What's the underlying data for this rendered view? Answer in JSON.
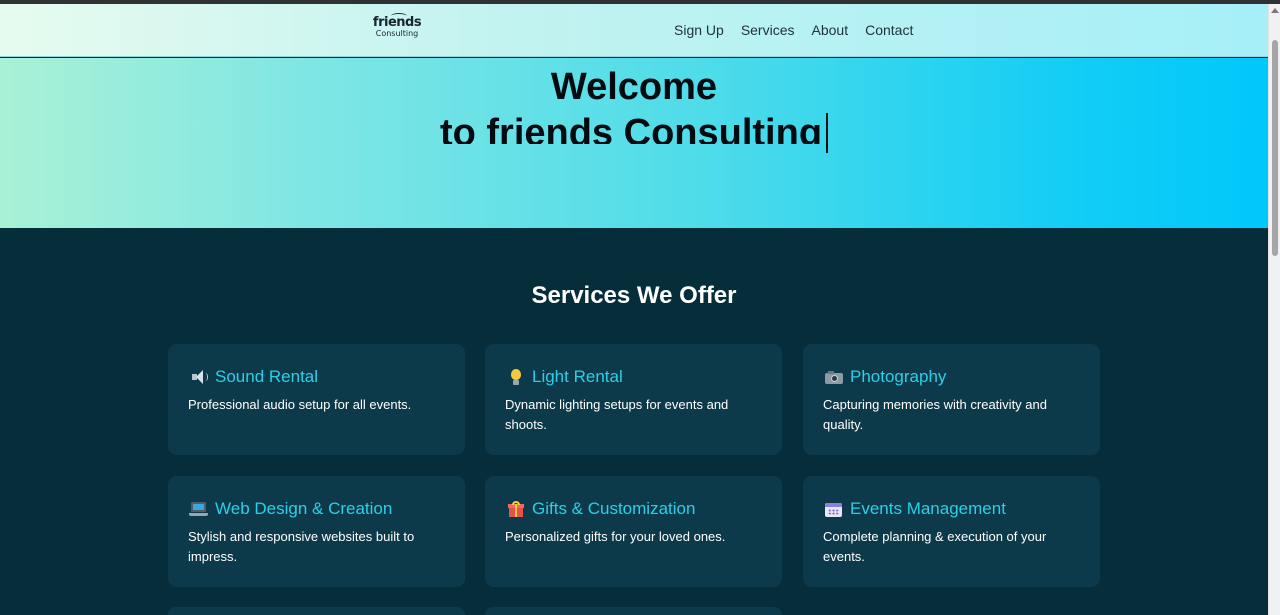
{
  "logo": {
    "main": "friends",
    "sub": "Consulting"
  },
  "nav": {
    "items": [
      "Sign Up",
      "Services",
      "About",
      "Contact"
    ]
  },
  "hero": {
    "line1": "Welcome",
    "line2": "to friends Consulting"
  },
  "services": {
    "title": "Services We Offer",
    "cards": [
      {
        "icon": "speaker-icon",
        "title": "Sound Rental",
        "desc": "Professional audio setup for all events."
      },
      {
        "icon": "light-bulb-icon",
        "title": "Light Rental",
        "desc": "Dynamic lighting setups for events and shoots."
      },
      {
        "icon": "camera-icon",
        "title": "Photography",
        "desc": "Capturing memories with creativity and quality."
      },
      {
        "icon": "laptop-icon",
        "title": "Web Design & Creation",
        "desc": "Stylish and responsive websites built to impress."
      },
      {
        "icon": "gift-icon",
        "title": "Gifts & Customization",
        "desc": "Personalized gifts for your loved ones."
      },
      {
        "icon": "calendar-icon",
        "title": "Events Management",
        "desc": "Complete planning & execution of your events."
      }
    ]
  },
  "colors": {
    "card_title": "#2ad0e7",
    "section_bg": "#062e3a",
    "card_bg": "#0d3a4a"
  }
}
